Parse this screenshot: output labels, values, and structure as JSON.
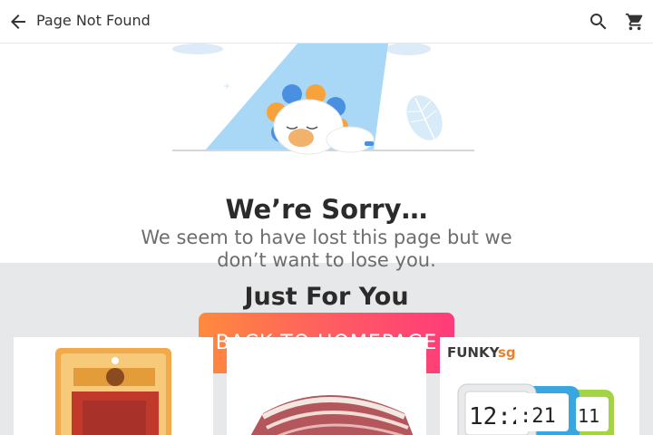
{
  "header": {
    "title": "Page Not Found"
  },
  "icons": {
    "back": "arrow-back-icon",
    "search": "search-icon",
    "cart": "shopping-cart-icon"
  },
  "message": {
    "heading": "We’re Sorry…",
    "body": "We seem to have lost this page but we don’t want to lose you.",
    "button": "BACK TO HOMEPAGE"
  },
  "recommendations": {
    "heading": "Just For You",
    "products": [
      {
        "name": "snack-pack-product"
      },
      {
        "name": "pork-belly-product"
      },
      {
        "name": "digital-alarm-clocks-product",
        "brand": "FUNKYsg"
      }
    ]
  },
  "colors": {
    "button_start": "#ff8a3d",
    "button_end": "#ff3b7a",
    "section_bg": "#e7e8ea"
  }
}
